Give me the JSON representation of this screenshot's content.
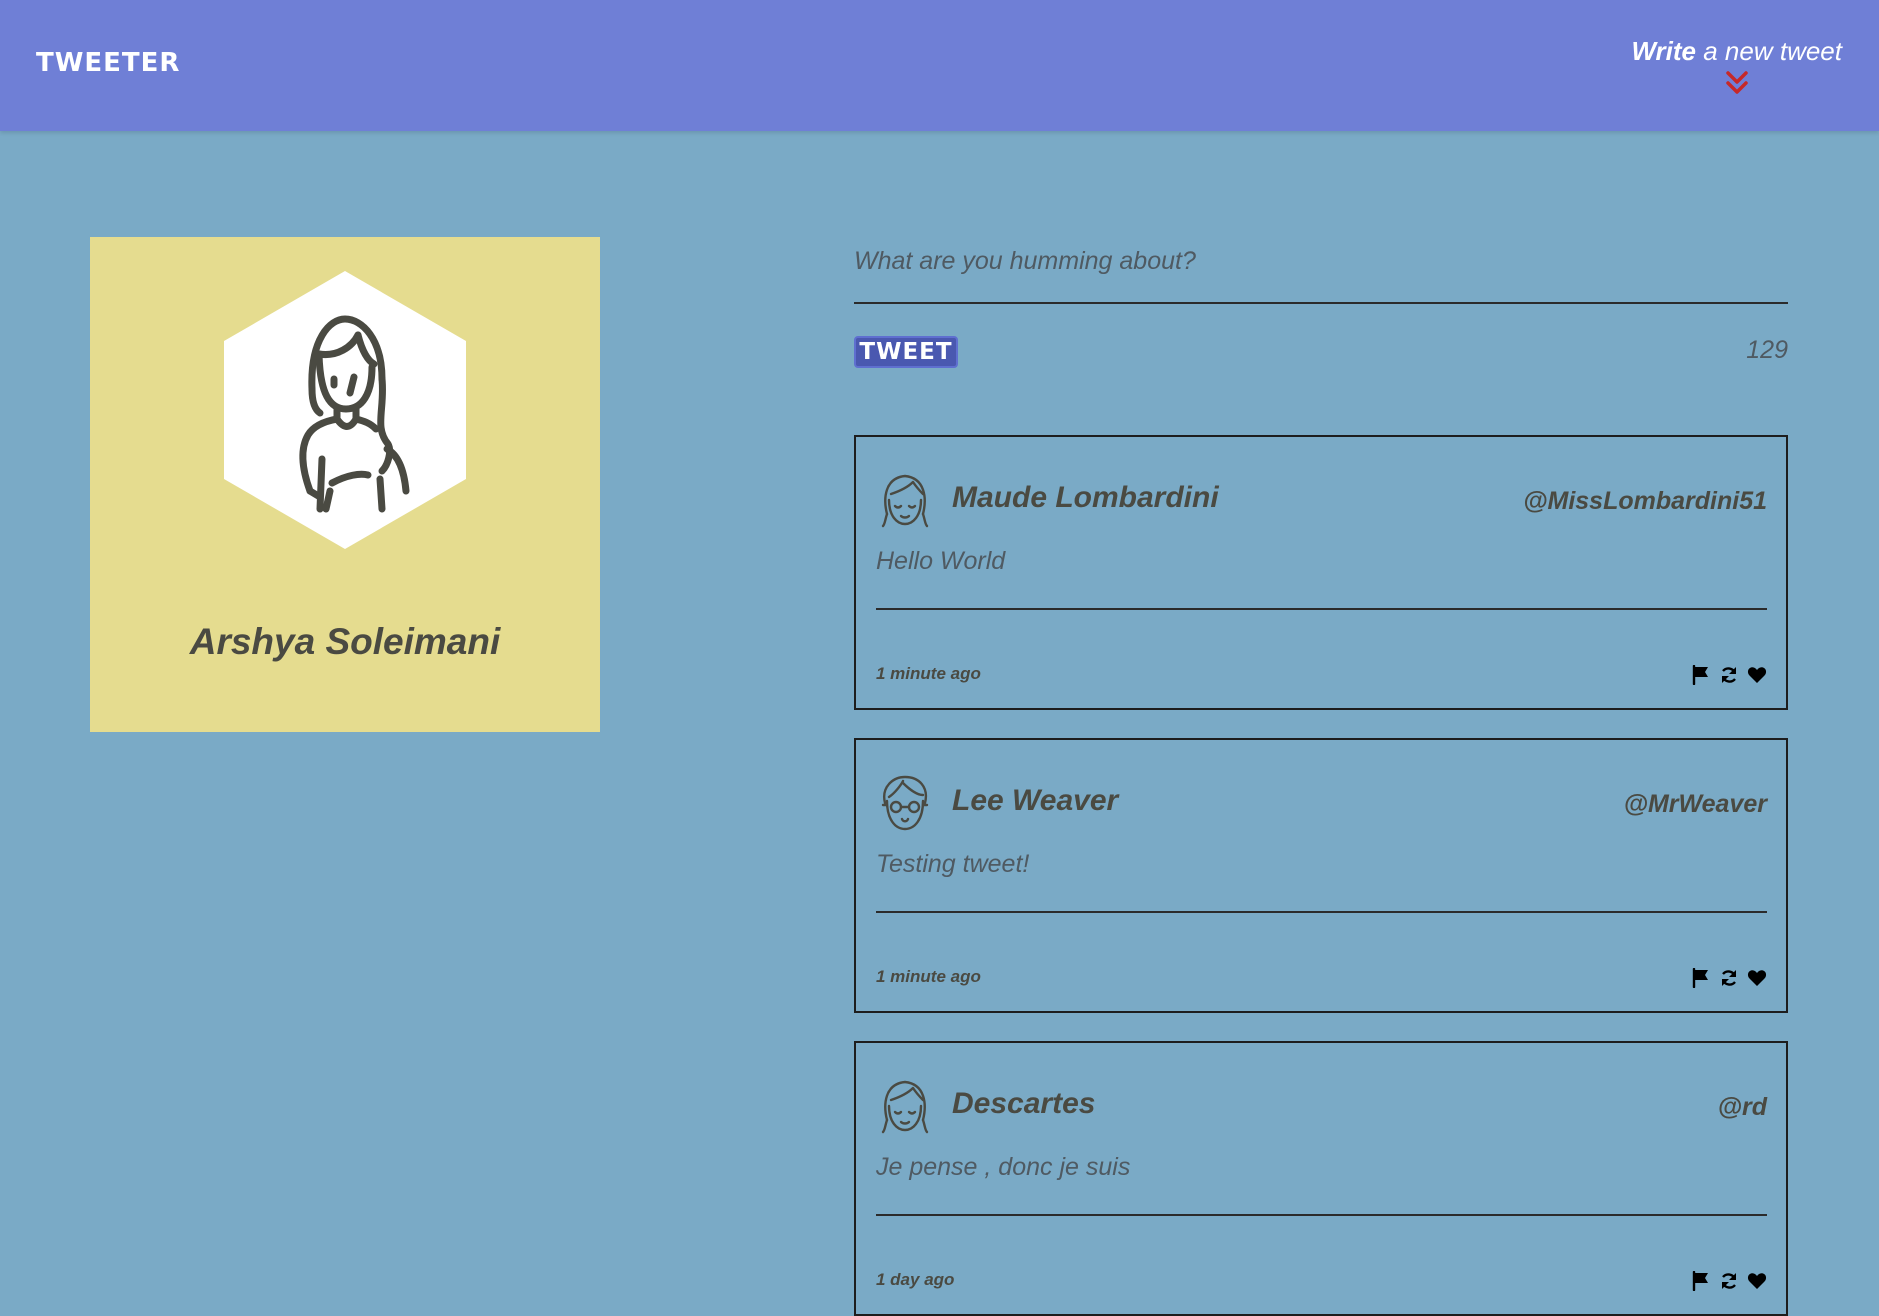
{
  "header": {
    "brand": "TWEETER",
    "compose_toggle_strong": "Write",
    "compose_toggle_rest": " a new tweet"
  },
  "profile": {
    "name": "Arshya Soleimani"
  },
  "composer": {
    "placeholder": "What are you humming about?",
    "button_label": "TWEET",
    "char_count": "129"
  },
  "tweets": [
    {
      "name": "Maude Lombardini",
      "handle": "@MissLombardini51",
      "body": "Hello World",
      "time": "1 minute ago"
    },
    {
      "name": "Lee Weaver",
      "handle": "@MrWeaver",
      "body": "Testing tweet!",
      "time": "1 minute ago"
    },
    {
      "name": "Descartes",
      "handle": "@rd",
      "body": "Je pense , donc je suis",
      "time": "1 day ago"
    }
  ],
  "icons": {
    "compose_toggle": "double-chevron-down-icon",
    "flag": "flag-icon",
    "retweet": "retweet-icon",
    "like": "heart-icon"
  },
  "colors": {
    "page_background": "#7aaac6",
    "header_background": "#6f7fd6",
    "profile_card": "#e5dc8f",
    "tweet_button": "#4a58b0",
    "accent_chevron": "#c62828"
  }
}
